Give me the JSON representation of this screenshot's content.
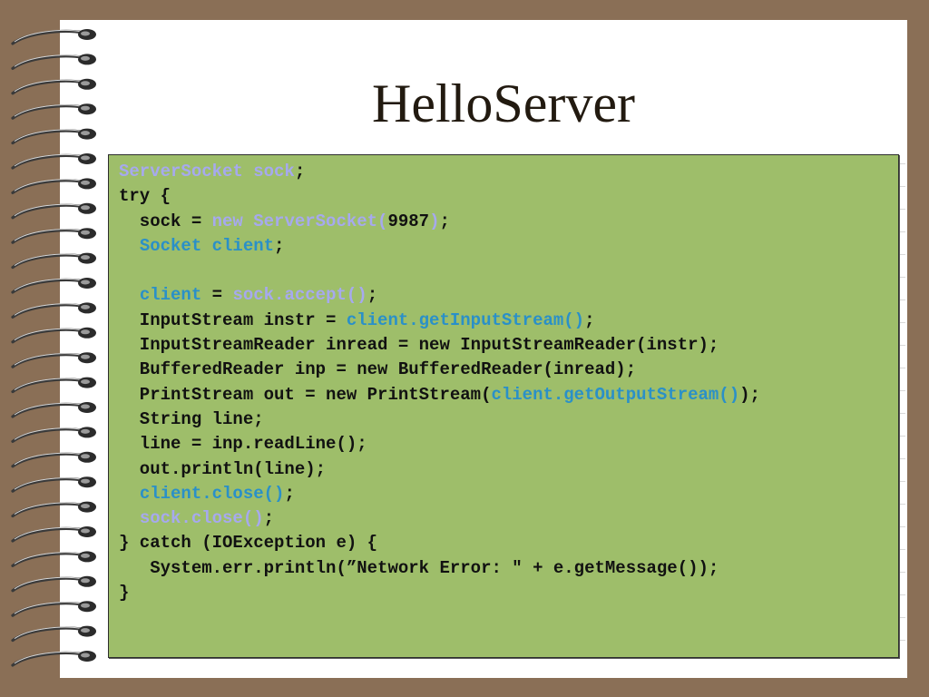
{
  "slide": {
    "title": "HelloServer"
  },
  "code_lines": [
    [
      {
        "t": "ServerSocket sock",
        "c": "lav"
      },
      {
        "t": ";",
        "c": "black"
      }
    ],
    [
      {
        "t": "try {",
        "c": "black"
      }
    ],
    [
      {
        "t": "  sock = ",
        "c": "black"
      },
      {
        "t": "new ServerSocket(",
        "c": "lav"
      },
      {
        "t": "9987",
        "c": "black"
      },
      {
        "t": ")",
        "c": "lav"
      },
      {
        "t": ";",
        "c": "black"
      }
    ],
    [
      {
        "t": "  ",
        "c": "black"
      },
      {
        "t": "Socket client",
        "c": "blue"
      },
      {
        "t": ";",
        "c": "black"
      }
    ],
    [
      {
        "t": "",
        "c": "black"
      }
    ],
    [
      {
        "t": "  ",
        "c": "black"
      },
      {
        "t": "client",
        "c": "blue"
      },
      {
        "t": " = ",
        "c": "black"
      },
      {
        "t": "sock.accept()",
        "c": "lav"
      },
      {
        "t": ";",
        "c": "black"
      }
    ],
    [
      {
        "t": "  InputStream instr = ",
        "c": "black"
      },
      {
        "t": "client.getInputStream()",
        "c": "blue"
      },
      {
        "t": ";",
        "c": "black"
      }
    ],
    [
      {
        "t": "  InputStreamReader inread = new InputStreamReader(instr);",
        "c": "black"
      }
    ],
    [
      {
        "t": "  BufferedReader inp = new BufferedReader(inread);",
        "c": "black"
      }
    ],
    [
      {
        "t": "  PrintStream out = new PrintStream(",
        "c": "black"
      },
      {
        "t": "client.getOutputStream()",
        "c": "blue"
      },
      {
        "t": ");",
        "c": "black"
      }
    ],
    [
      {
        "t": "  String line;",
        "c": "black"
      }
    ],
    [
      {
        "t": "  line = inp.readLine();",
        "c": "black"
      }
    ],
    [
      {
        "t": "  out.println(line);",
        "c": "black"
      }
    ],
    [
      {
        "t": "  ",
        "c": "black"
      },
      {
        "t": "client.close()",
        "c": "blue"
      },
      {
        "t": ";",
        "c": "black"
      }
    ],
    [
      {
        "t": "  ",
        "c": "black"
      },
      {
        "t": "sock.close()",
        "c": "lav"
      },
      {
        "t": ";",
        "c": "black"
      }
    ],
    [
      {
        "t": "} catch (IOException e) {",
        "c": "black"
      }
    ],
    [
      {
        "t": "   System.err.println(”Network Error: \" + e.getMessage());",
        "c": "black"
      }
    ],
    [
      {
        "t": "}",
        "c": "black"
      }
    ]
  ],
  "colors": {
    "background": "#8a6f56",
    "page": "#ffffff",
    "code_box": "#9ebe6a",
    "keyword_lavender": "#a6a9ee",
    "keyword_blue": "#2a90c8"
  },
  "decoration": {
    "binding": "spiral-binding-icon"
  }
}
